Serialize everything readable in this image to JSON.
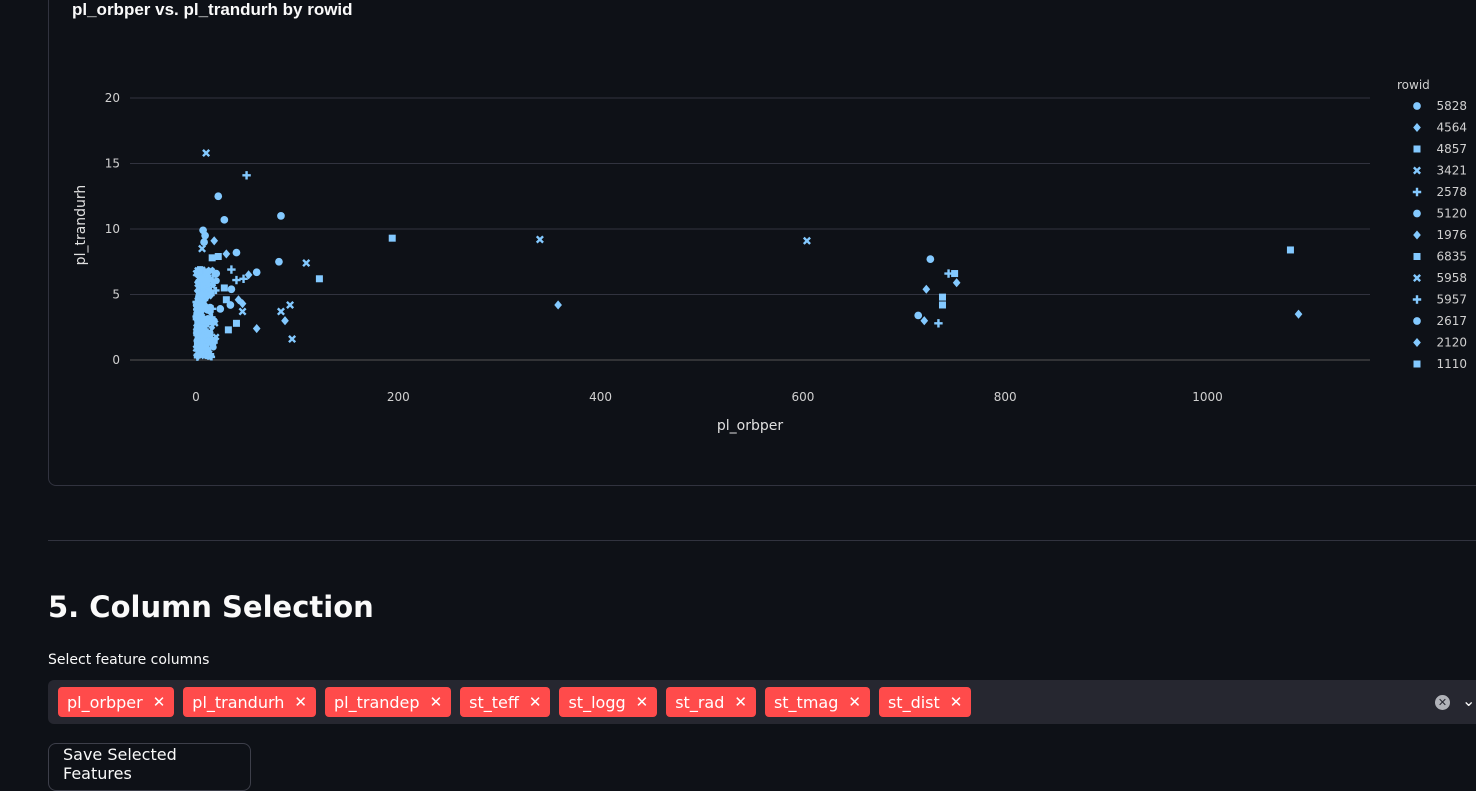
{
  "chart": {
    "title": "pl_orbper vs. pl_trandurh by rowid",
    "xlabel": "pl_orbper",
    "ylabel": "pl_trandurh",
    "legend_title": "rowid",
    "point_color": "#83c9ff"
  },
  "chart_data": {
    "type": "scatter",
    "title": "pl_orbper vs. pl_trandurh by rowid",
    "xlabel": "pl_orbper",
    "ylabel": "pl_trandurh",
    "xlim": [
      -40,
      1160
    ],
    "ylim": [
      0,
      20
    ],
    "x_ticks": [
      0,
      200,
      400,
      600,
      800,
      1000
    ],
    "y_ticks": [
      0,
      5,
      10,
      15,
      20
    ],
    "grid": "horizontal",
    "legend_placement": "right",
    "legend": [
      {
        "label": "5828",
        "shape": "circle"
      },
      {
        "label": "4564",
        "shape": "diamond"
      },
      {
        "label": "4857",
        "shape": "square"
      },
      {
        "label": "3421",
        "shape": "cross"
      },
      {
        "label": "2578",
        "shape": "plus"
      },
      {
        "label": "5120",
        "shape": "circle"
      },
      {
        "label": "1976",
        "shape": "diamond"
      },
      {
        "label": "6835",
        "shape": "square"
      },
      {
        "label": "5958",
        "shape": "cross"
      },
      {
        "label": "5957",
        "shape": "plus"
      },
      {
        "label": "2617",
        "shape": "circle"
      },
      {
        "label": "2120",
        "shape": "diamond"
      },
      {
        "label": "1110",
        "shape": "square"
      }
    ],
    "points": [
      {
        "x": 10,
        "y": 15.8,
        "shape": "cross"
      },
      {
        "x": 50,
        "y": 14.1,
        "shape": "plus"
      },
      {
        "x": 22,
        "y": 12.5,
        "shape": "circle"
      },
      {
        "x": 28,
        "y": 10.7,
        "shape": "circle"
      },
      {
        "x": 84,
        "y": 11.0,
        "shape": "circle"
      },
      {
        "x": 7,
        "y": 9.9,
        "shape": "circle"
      },
      {
        "x": 9,
        "y": 9.5,
        "shape": "circle"
      },
      {
        "x": 8,
        "y": 9.0,
        "shape": "circle"
      },
      {
        "x": 18,
        "y": 9.1,
        "shape": "diamond"
      },
      {
        "x": 6,
        "y": 8.5,
        "shape": "cross"
      },
      {
        "x": 40,
        "y": 8.2,
        "shape": "circle"
      },
      {
        "x": 30,
        "y": 8.1,
        "shape": "diamond"
      },
      {
        "x": 16,
        "y": 7.8,
        "shape": "square"
      },
      {
        "x": 22,
        "y": 7.9,
        "shape": "square"
      },
      {
        "x": 82,
        "y": 7.5,
        "shape": "circle"
      },
      {
        "x": 109,
        "y": 7.4,
        "shape": "cross"
      },
      {
        "x": 35,
        "y": 6.9,
        "shape": "plus"
      },
      {
        "x": 60,
        "y": 6.7,
        "shape": "circle"
      },
      {
        "x": 52,
        "y": 6.5,
        "shape": "diamond"
      },
      {
        "x": 122,
        "y": 6.2,
        "shape": "square"
      },
      {
        "x": 40,
        "y": 6.1,
        "shape": "plus"
      },
      {
        "x": 47,
        "y": 6.2,
        "shape": "plus"
      },
      {
        "x": 20,
        "y": 6.6,
        "shape": "circle"
      },
      {
        "x": 35,
        "y": 5.4,
        "shape": "circle"
      },
      {
        "x": 28,
        "y": 5.5,
        "shape": "square"
      },
      {
        "x": 42,
        "y": 4.6,
        "shape": "diamond"
      },
      {
        "x": 46,
        "y": 4.3,
        "shape": "diamond"
      },
      {
        "x": 30,
        "y": 4.6,
        "shape": "square"
      },
      {
        "x": 34,
        "y": 4.2,
        "shape": "circle"
      },
      {
        "x": 93,
        "y": 4.2,
        "shape": "cross"
      },
      {
        "x": 84,
        "y": 3.7,
        "shape": "cross"
      },
      {
        "x": 46,
        "y": 3.7,
        "shape": "cross"
      },
      {
        "x": 24,
        "y": 3.9,
        "shape": "circle"
      },
      {
        "x": 88,
        "y": 3.0,
        "shape": "diamond"
      },
      {
        "x": 40,
        "y": 2.8,
        "shape": "square"
      },
      {
        "x": 60,
        "y": 2.4,
        "shape": "diamond"
      },
      {
        "x": 32,
        "y": 2.3,
        "shape": "square"
      },
      {
        "x": 95,
        "y": 1.6,
        "shape": "cross"
      },
      {
        "x": 18,
        "y": 1.5,
        "shape": "square"
      },
      {
        "x": 2,
        "y": 0.3,
        "shape": "diamond"
      },
      {
        "x": 4,
        "y": 1.0,
        "shape": "circle"
      },
      {
        "x": 12,
        "y": 2.0,
        "shape": "circle"
      },
      {
        "x": 8,
        "y": 3.0,
        "shape": "square"
      },
      {
        "x": 14,
        "y": 4.0,
        "shape": "circle"
      },
      {
        "x": 6,
        "y": 5.0,
        "shape": "diamond"
      },
      {
        "x": 10,
        "y": 6.0,
        "shape": "circle"
      },
      {
        "x": 3,
        "y": 6.8,
        "shape": "square"
      },
      {
        "x": 194,
        "y": 9.3,
        "shape": "square"
      },
      {
        "x": 340,
        "y": 9.2,
        "shape": "cross"
      },
      {
        "x": 358,
        "y": 4.2,
        "shape": "diamond"
      },
      {
        "x": 604,
        "y": 9.1,
        "shape": "cross"
      },
      {
        "x": 726,
        "y": 7.7,
        "shape": "circle"
      },
      {
        "x": 744,
        "y": 6.6,
        "shape": "plus"
      },
      {
        "x": 750,
        "y": 6.6,
        "shape": "square"
      },
      {
        "x": 752,
        "y": 5.9,
        "shape": "diamond"
      },
      {
        "x": 722,
        "y": 5.4,
        "shape": "diamond"
      },
      {
        "x": 738,
        "y": 4.8,
        "shape": "square"
      },
      {
        "x": 738,
        "y": 4.2,
        "shape": "square"
      },
      {
        "x": 714,
        "y": 3.4,
        "shape": "circle"
      },
      {
        "x": 720,
        "y": 3.0,
        "shape": "diamond"
      },
      {
        "x": 734,
        "y": 2.8,
        "shape": "plus"
      },
      {
        "x": 1082,
        "y": 8.4,
        "shape": "square"
      },
      {
        "x": 1090,
        "y": 3.5,
        "shape": "diamond"
      }
    ],
    "dense_cluster": {
      "x_range": [
        0,
        22
      ],
      "y_range": [
        0.2,
        7.0
      ]
    }
  },
  "section": {
    "heading": "5. Column Selection",
    "select_label": "Select feature columns",
    "tags": [
      "pl_orbper",
      "pl_trandurh",
      "pl_trandep",
      "st_teff",
      "st_logg",
      "st_rad",
      "st_tmag",
      "st_dist"
    ],
    "remove_glyph": "✕",
    "clear_glyph": "✕",
    "chevron_glyph": "⌄"
  },
  "save_button_label": "Save Selected Features",
  "colors": {
    "background": "#0e1117",
    "tag": "#ff4b4b",
    "input_bg": "#262730",
    "point": "#83c9ff"
  }
}
